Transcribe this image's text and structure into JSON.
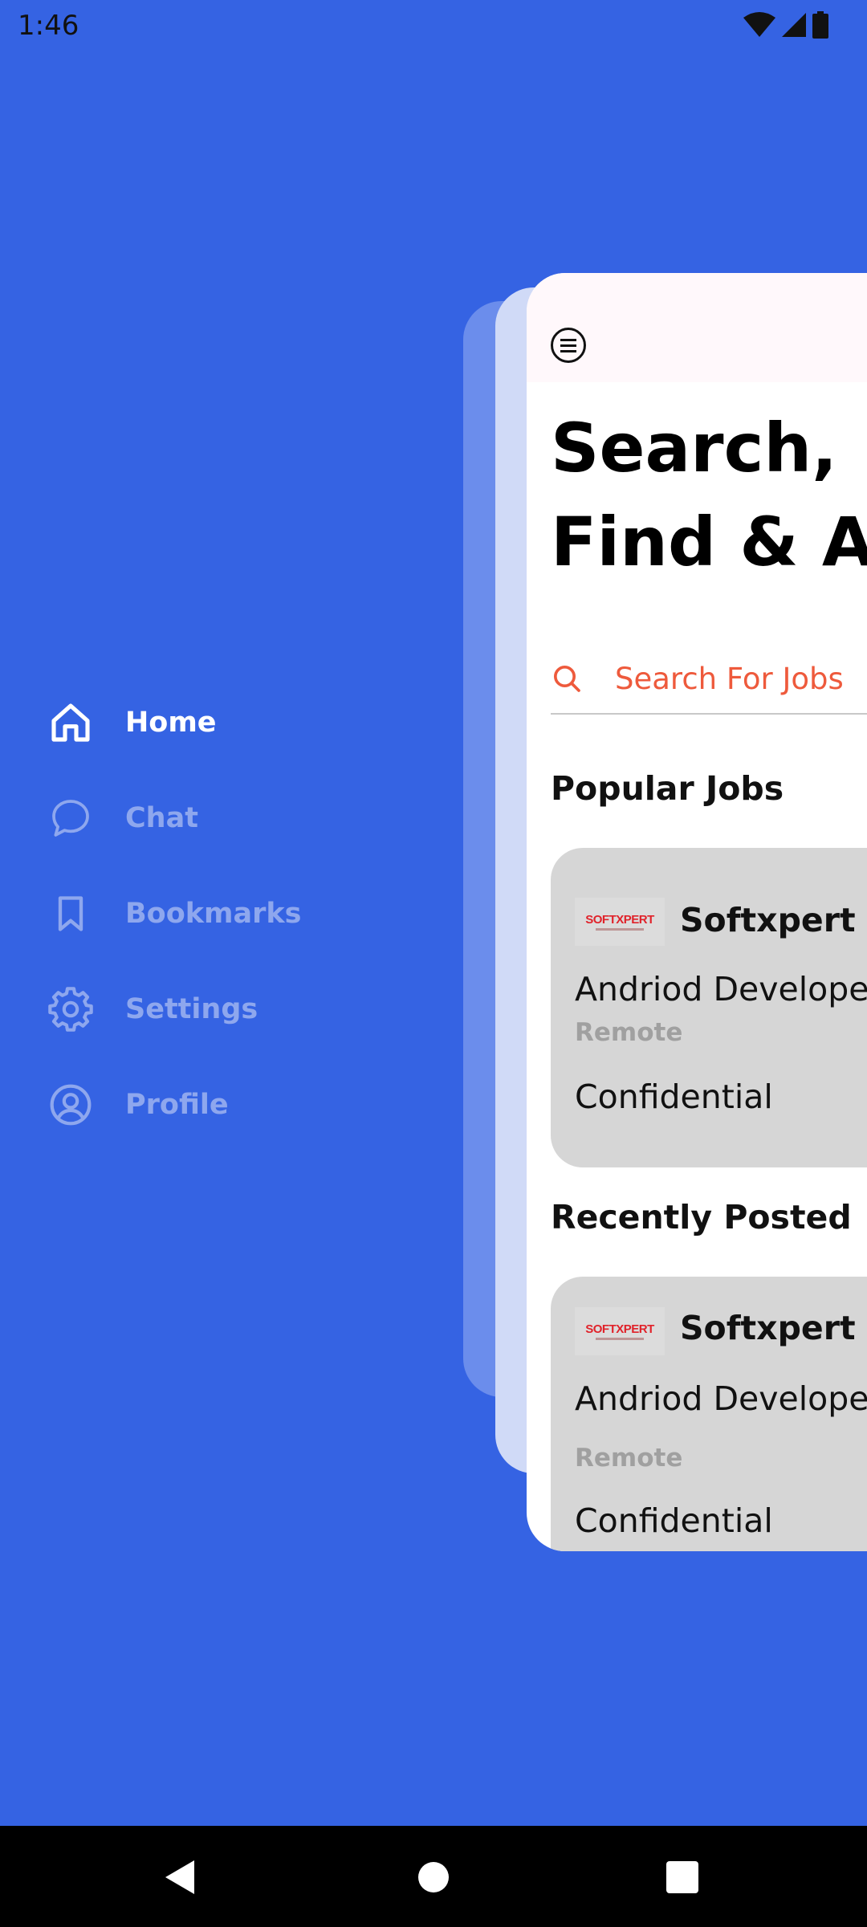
{
  "status_bar": {
    "time": "1:46"
  },
  "drawer": {
    "items": [
      {
        "label": "Home",
        "icon": "home-icon",
        "active": true
      },
      {
        "label": "Chat",
        "icon": "chat-icon",
        "active": false
      },
      {
        "label": "Bookmarks",
        "icon": "bookmark-icon",
        "active": false
      },
      {
        "label": "Settings",
        "icon": "gear-icon",
        "active": false
      },
      {
        "label": "Profile",
        "icon": "profile-icon",
        "active": false
      }
    ]
  },
  "main": {
    "headline_line1": "Search,",
    "headline_line2": "Find & Ap",
    "search": {
      "placeholder": "Search For Jobs"
    },
    "popular": {
      "title": "Popular Jobs",
      "jobs": [
        {
          "logo": "SOFTXPERT",
          "company": "Softxpert In",
          "title": "Andriod Develope",
          "location": "Remote",
          "salary": "Confidential"
        }
      ]
    },
    "recent": {
      "title": "Recently Posted",
      "jobs": [
        {
          "logo": "SOFTXPERT",
          "company": "Softxpert In",
          "title": "Andriod Develope",
          "location": "Remote",
          "salary": "Confidential"
        }
      ]
    }
  },
  "colors": {
    "background": "#3563E3",
    "accent_search": "#EE5A3C",
    "menu_active": "#FFFFFF",
    "menu_inactive": "#8EA7EE",
    "job_card": "#D6D6D6"
  }
}
